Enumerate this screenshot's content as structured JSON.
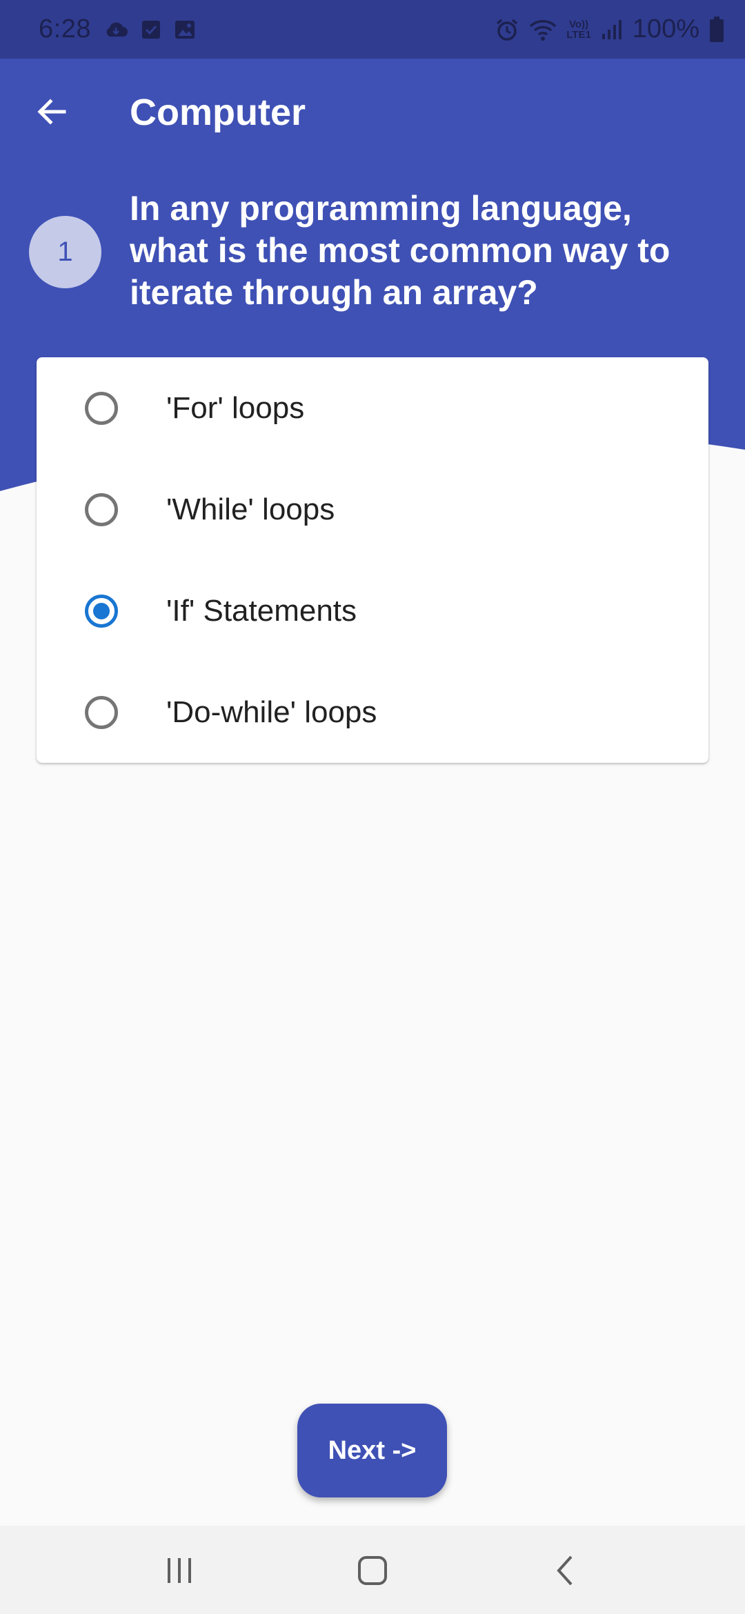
{
  "status_bar": {
    "time": "6:28",
    "battery_text": "100%",
    "left_icons": [
      "cloud-download-icon",
      "checkbox-icon",
      "image-icon"
    ],
    "right_icons": [
      "alarm-icon",
      "wifi-icon",
      "volte-lte-icon",
      "signal-icon",
      "battery-icon"
    ],
    "volte_line1": "Vo))",
    "volte_line2": "LTE1"
  },
  "app_bar": {
    "title": "Computer",
    "back_icon": "arrow-back-icon"
  },
  "question": {
    "number": "1",
    "text": "In any programming language, what is the most common way to iterate through an array?"
  },
  "options": [
    {
      "label": "'For' loops",
      "selected": false
    },
    {
      "label": "'While' loops",
      "selected": false
    },
    {
      "label": "'If' Statements",
      "selected": true
    },
    {
      "label": "'Do-while' loops",
      "selected": false
    }
  ],
  "next_button": {
    "label": "Next ->"
  },
  "nav_bar": {
    "icons": [
      "recent-apps-icon",
      "home-icon",
      "back-icon"
    ]
  },
  "colors": {
    "primary": "#3f51b5",
    "status_bar": "#303c8f",
    "accent_radio": "#1976d2",
    "number_badge_bg": "#c5cae9",
    "background": "#fafafa"
  }
}
